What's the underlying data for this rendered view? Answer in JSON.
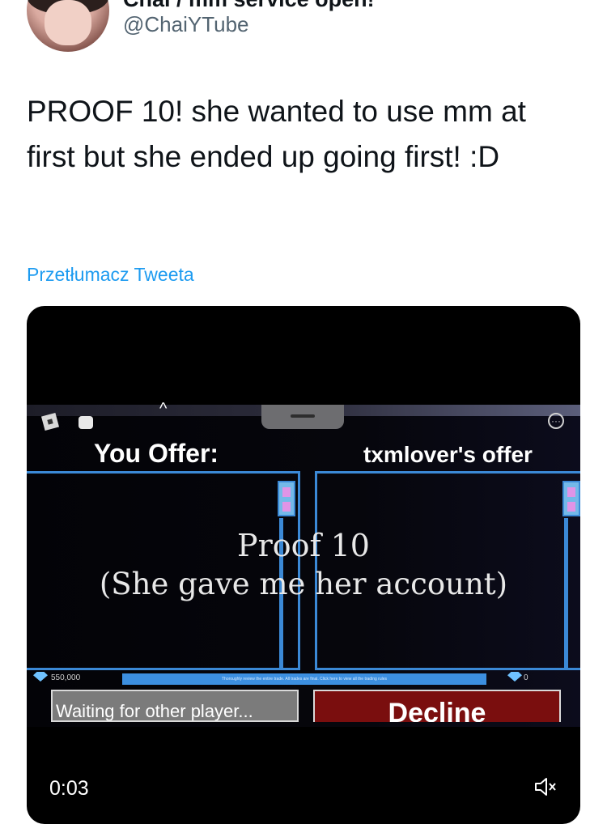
{
  "author": {
    "display_name": "Chai / mm service open!",
    "handle": "@ChaiYTube"
  },
  "tweet": {
    "text": "PROOF 10! she wanted to use mm at first but she ended up going first! :D",
    "translate_link": "Przetłumacz Tweeta"
  },
  "video": {
    "timestamp": "0:03",
    "mute_icon": "volume-muted-icon",
    "game": {
      "you_offer_label": "You Offer:",
      "other_offer_label": "txmlover's offer",
      "overlay_line1": "Proof 10",
      "overlay_line2": "(She gave me her account)",
      "robux_left": "550,000",
      "robux_right": "0",
      "notice": "Thoroughly review the entire trade. All trades are final. Click here to view all the trading rules",
      "waiting_button": "Waiting for other player...",
      "decline_button": "Decline"
    }
  }
}
